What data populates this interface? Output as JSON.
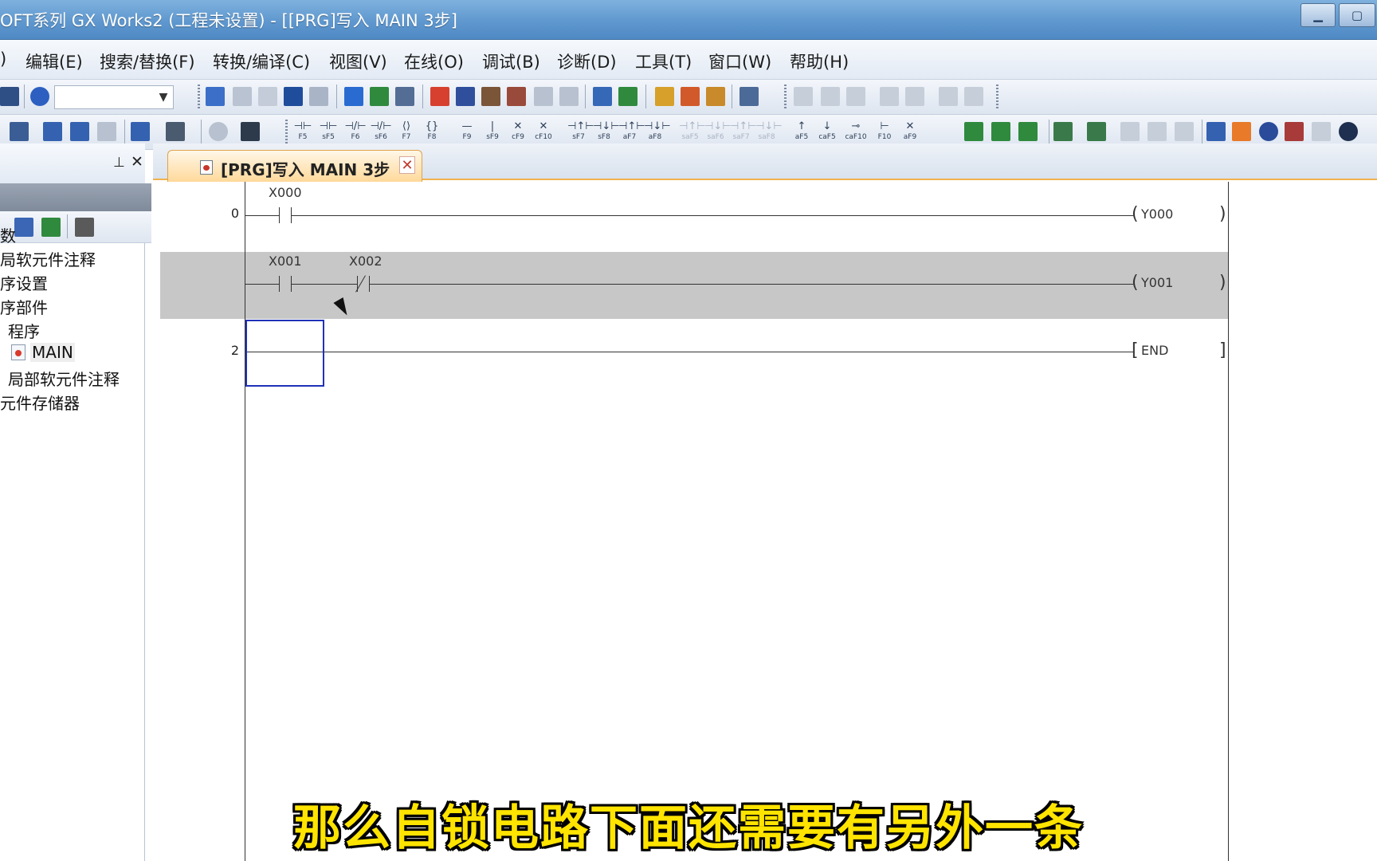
{
  "window": {
    "title": "OFT系列 GX Works2 (工程未设置) - [[PRG]写入 MAIN 3步]",
    "minimize_label": "▁",
    "maximize_label": "▢"
  },
  "menu": {
    "items": [
      ")",
      "编辑(E)",
      "搜索/替换(F)",
      "转换/编译(C)",
      "视图(V)",
      "在线(O)",
      "调试(B)",
      "诊断(D)",
      "工具(T)",
      "窗口(W)",
      "帮助(H)"
    ]
  },
  "toolbar": {
    "fkeys": [
      {
        "sym": "⊣⊢",
        "label": "F5"
      },
      {
        "sym": "⊣⊢",
        "label": "sF5"
      },
      {
        "sym": "⊣/⊢",
        "label": "F6"
      },
      {
        "sym": "⊣/⊢",
        "label": "sF6"
      },
      {
        "sym": "⟨⟩",
        "label": "F7"
      },
      {
        "sym": "{}",
        "label": "F8"
      },
      {
        "sym": "—",
        "label": "F9"
      },
      {
        "sym": "|",
        "label": "sF9"
      },
      {
        "sym": "✕",
        "label": "cF9"
      },
      {
        "sym": "✕",
        "label": "cF10"
      },
      {
        "sym": "⊣↑⊢",
        "label": "sF7"
      },
      {
        "sym": "⊣↓⊢",
        "label": "sF8"
      },
      {
        "sym": "⊣↑⊢",
        "label": "aF7"
      },
      {
        "sym": "⊣↓⊢",
        "label": "aF8"
      },
      {
        "sym": "⊣↑⊢",
        "label": "saF5",
        "disabled": true
      },
      {
        "sym": "⊣↓⊢",
        "label": "saF6",
        "disabled": true
      },
      {
        "sym": "⊣↑⊢",
        "label": "saF7",
        "disabled": true
      },
      {
        "sym": "⊣↓⊢",
        "label": "saF8",
        "disabled": true
      },
      {
        "sym": "↑",
        "label": "aF5"
      },
      {
        "sym": "↓",
        "label": "caF5"
      },
      {
        "sym": "⊸",
        "label": "caF10"
      },
      {
        "sym": "⊢",
        "label": "F10"
      },
      {
        "sym": "✕",
        "label": "aF9"
      }
    ]
  },
  "nav": {
    "pin": "⊥",
    "close": "✕",
    "tree": [
      {
        "label": "数"
      },
      {
        "label": "局软元件注释"
      },
      {
        "label": "序设置"
      },
      {
        "label": "序部件"
      },
      {
        "label": "程序"
      },
      {
        "label": "MAIN"
      },
      {
        "label": "局部软元件注释"
      },
      {
        "label": "元件存储器"
      }
    ]
  },
  "editor": {
    "tab_label": "[PRG]写入 MAIN 3步",
    "tab_close": "✕",
    "rungs": [
      {
        "step": "0",
        "contacts": [
          "X000"
        ],
        "coil": "Y000"
      },
      {
        "step": "",
        "contacts": [
          "X001",
          "X002"
        ],
        "coil": "Y001"
      },
      {
        "step": "2",
        "instruction": "END"
      }
    ]
  },
  "subtitle": "那么自锁电路下面还需要有另外一条"
}
